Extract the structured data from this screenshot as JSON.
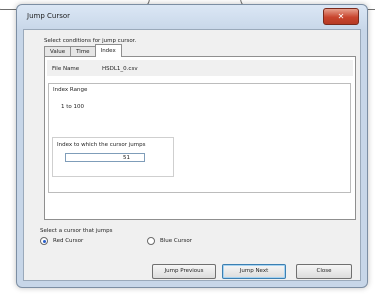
{
  "dialog": {
    "title": "Jump Cursor",
    "close_glyph": "✕",
    "conditions_label": "Select conditions for jump cursor.",
    "tabs": [
      {
        "label": "Value",
        "active": false
      },
      {
        "label": "Time",
        "active": false
      },
      {
        "label": "Index",
        "active": true
      }
    ],
    "file_name_label": "File Name",
    "file_name_value": "HSDL1_0.csv",
    "index_range_label": "Index Range",
    "index_range_value": "1 to 100",
    "jump_index_label": "Index to which the cursor jumps",
    "jump_index_value": "51",
    "cursor_select_label": "Select a cursor that jumps",
    "cursors": [
      {
        "label": "Red Cursor",
        "checked": true
      },
      {
        "label": "Blue Cursor",
        "checked": false
      }
    ],
    "buttons": {
      "previous": "Jump Previous",
      "next": "Jump Next",
      "close": "Close"
    }
  },
  "colors": {
    "frame": "#c7d6e8",
    "close_button": "#c8452e",
    "radio_selected": "#2a5ec8"
  },
  "icons": {
    "close": "close-icon"
  }
}
